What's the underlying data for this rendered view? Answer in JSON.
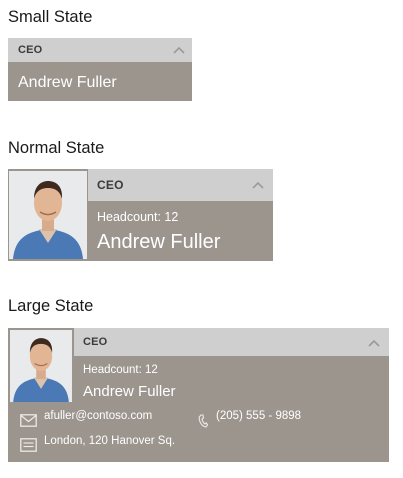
{
  "small": {
    "heading": "Small State",
    "title": "CEO",
    "name": "Andrew  Fuller"
  },
  "normal": {
    "heading": "Normal State",
    "title": "CEO",
    "headcount": "Headcount: 12",
    "name": "Andrew Fuller"
  },
  "large": {
    "heading": "Large State",
    "title": "CEO",
    "headcount": "Headcount:  12",
    "name": "Andrew Fuller",
    "email": "afuller@contoso.com",
    "phone": "(205) 555 - 9898",
    "address": "London, 120 Hanover Sq."
  },
  "icons": {
    "collapse": "chevron-up-icon",
    "email": "envelope-icon",
    "phone": "phone-icon",
    "address": "address-card-icon"
  },
  "colors": {
    "card_body": "#9b958e",
    "card_header": "#d0cfcf",
    "name_text": "#ffffff"
  }
}
